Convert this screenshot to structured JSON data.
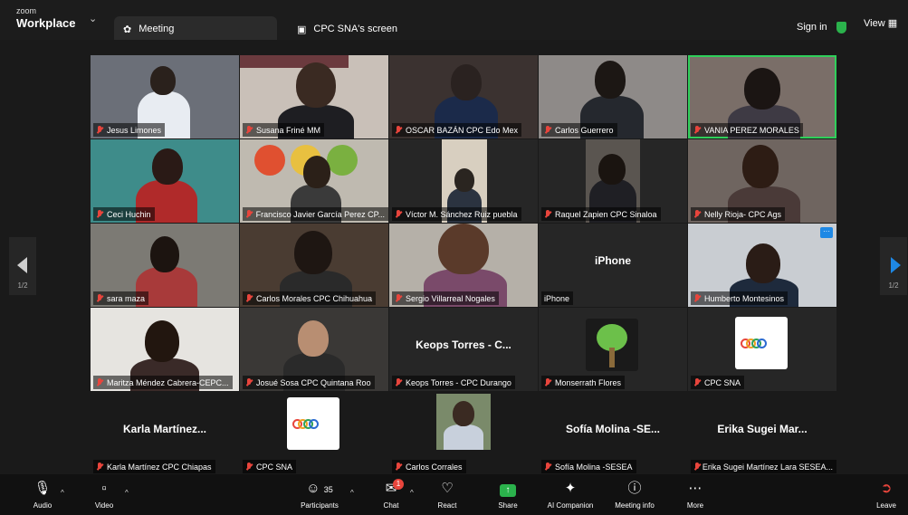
{
  "app": {
    "logo_line1": "zoom",
    "logo_line2": "Workplace"
  },
  "tabs": [
    {
      "label": "Meeting"
    },
    {
      "label": "CPC SNA's screen"
    }
  ],
  "topbar": {
    "sign_in": "Sign in",
    "view": "View"
  },
  "pager": {
    "left": "1/2",
    "right": "1/2"
  },
  "tiles": [
    {
      "name": "Jesus Limones"
    },
    {
      "name": "Susana Friné MM"
    },
    {
      "name": "OSCAR BAZÁN CPC Edo Mex"
    },
    {
      "name": "Carlos Guerrero"
    },
    {
      "name": "VANIA PEREZ MORALES"
    },
    {
      "name": "Ceci Huchin"
    },
    {
      "name": "Francisco Javier García Perez CP..."
    },
    {
      "name": "Víctor M. Sánchez Ruiz  puebla"
    },
    {
      "name": "Raquel Zapien CPC Sinaloa"
    },
    {
      "name": "Nelly Rioja- CPC Ags"
    },
    {
      "name": "sara maza"
    },
    {
      "name": "Carlos Morales CPC Chihuahua"
    },
    {
      "name": "Sergio Villarreal Nogales"
    },
    {
      "name": "iPhone",
      "center": "iPhone"
    },
    {
      "name": "Humberto Montesinos"
    },
    {
      "name": "Maritza Méndez Cabrera-CEPC..."
    },
    {
      "name": "Josué Sosa CPC Quintana Roo"
    },
    {
      "name": "Keops Torres - CPC Durango",
      "center": "Keops Torres - C..."
    },
    {
      "name": "Monserrath Flores"
    },
    {
      "name": "CPC SNA"
    },
    {
      "name": "Karla Martínez CPC Chiapas",
      "center": "Karla  Martínez..."
    },
    {
      "name": "CPC SNA"
    },
    {
      "name": "Carlos Corrales"
    },
    {
      "name": "Sofía Molina -SESEA",
      "center": "Sofía Molina -SE..."
    },
    {
      "name": "Erika Sugei Martínez Lara SESEA...",
      "center": "Erika Sugei Mar..."
    }
  ],
  "toolbar": {
    "audio": "Audio",
    "video": "Video",
    "participants": "Participants",
    "participants_count": "35",
    "chat": "Chat",
    "chat_badge": "1",
    "react": "React",
    "share": "Share",
    "ai": "AI Companion",
    "info": "Meeting info",
    "more": "More",
    "leave": "Leave"
  },
  "colors": {
    "accent": "#2fcf5a",
    "mute": "#e8453c",
    "share": "#2bb24c",
    "pager_arrow": "#1e88e5"
  }
}
